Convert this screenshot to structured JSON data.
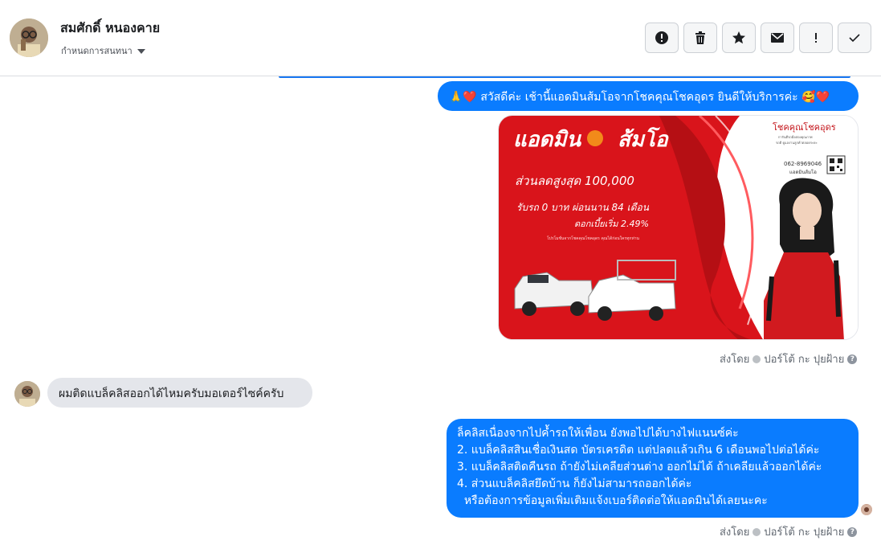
{
  "header": {
    "name": "สมศักดิ์ หนองคาย",
    "conversation_setting": "กำหนดการสนทนา",
    "tools": [
      {
        "icon": "alert-circle-icon",
        "label": ""
      },
      {
        "icon": "trash-icon",
        "label": ""
      },
      {
        "icon": "star-icon",
        "label": ""
      },
      {
        "icon": "envelope-icon",
        "label": ""
      },
      {
        "icon": "exclamation-icon",
        "label": ""
      },
      {
        "icon": "checkmark-icon",
        "label": ""
      }
    ]
  },
  "messages": {
    "greeting": "🙏❤️ สวัสดีค่ะ เช้านี้แอดมินส้มโอจากโชคคุณโชคอุดร ยินดีให้บริการค่ะ 🥰❤️",
    "sent_by_1": {
      "prefix": "ส่งโดย",
      "agent": "ปอร์โต้ กะ ปุยฝ้าย"
    },
    "incoming": "ผมติดแบล็คลิสออกได้ไหมครับมอเตอร์ไซค์ครับ",
    "reply_lines": [
      "ล็คลิสเนื่องจากไปค้ำรถให้เพื่อน ยังพอไปได้บางไฟแนนซ์ค่ะ",
      "2. แบล็คลิสสินเชื่อเงินสด บัตรเครดิต แต่ปลดแล้วเกิน 6 เดือนพอไปต่อได้ค่ะ",
      "3. แบล็คลิสติดคืนรถ ถ้ายังไม่เคลียส่วนต่าง ออกไม่ได้ ถ้าเคลียแล้วออกได้ค่ะ",
      "4. ส่วนแบล็คลิสยึดบ้าน ก็ยังไม่สามารถออกได้ค่ะ",
      "  หรือต้องการข้อมูลเพิ่มเติมแจ้งเบอร์ติดต่อให้แอดมินได้เลยนะคะ"
    ],
    "sent_by_2": {
      "prefix": "ส่งโดย",
      "agent": "ปอร์โต้ กะ ปุยฝ้าย"
    }
  },
  "promo": {
    "title": "แอดมิน",
    "title2": "ส้มโอ",
    "brand": "โชคคุณโชคอุดร",
    "brand_sub": "การันตีรถมือสองคุณภาพ",
    "brand_sub2": "รถดี ดูแลงานลูกค้าตลอดระยะ",
    "phone": "062-8969046",
    "phone_caption": "แอดมินส้มโอ",
    "discount": "ส่วนลดสูงสุด 100,000",
    "down": "รับรถ 0 บาท ผ่อนนาน 84 เดือน",
    "interest": "ดอกเบี้ยเริ่ม 2.49%",
    "fineprint": "โปรโมชั่นจากโชคคุณโชคอุดร คุณได้ก่อนใครทุกท่าน",
    "plate1": "",
    "plate2": ""
  }
}
